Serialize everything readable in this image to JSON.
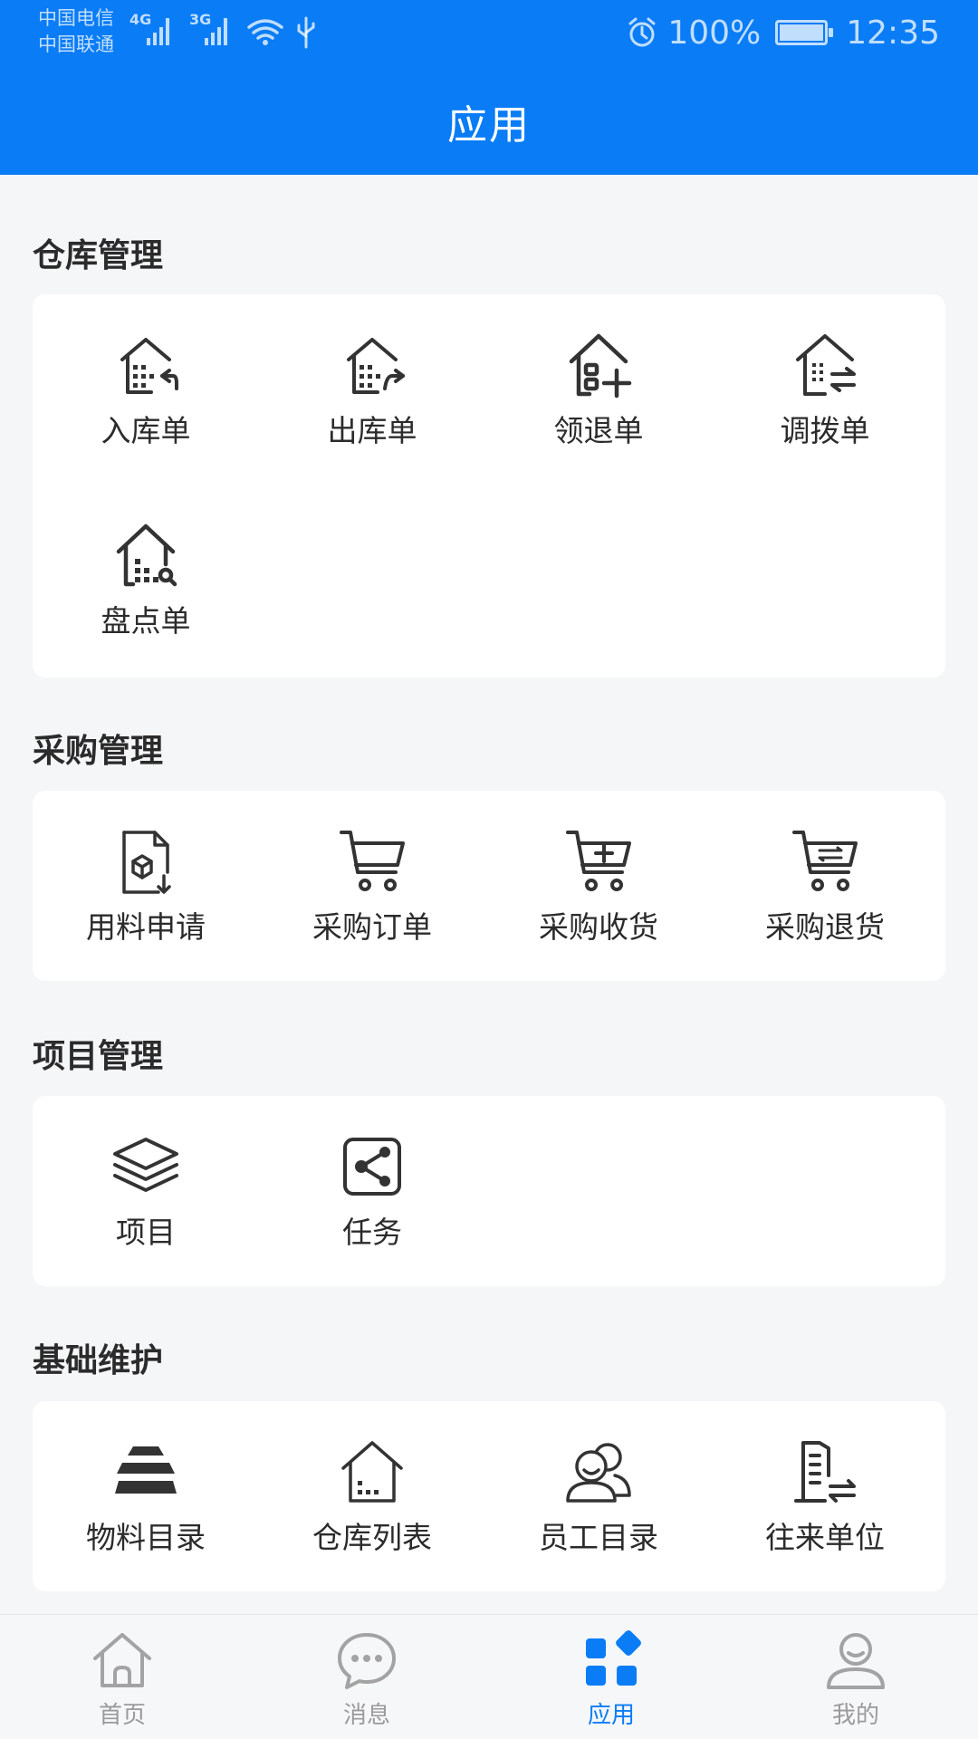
{
  "status_bar": {
    "carrier_1": "中国电信",
    "carrier_2": "中国联通",
    "net_1": "4G",
    "net_2": "3G",
    "battery": "100%",
    "time": "12:35"
  },
  "header": {
    "title": "应用"
  },
  "sections": [
    {
      "title": "仓库管理",
      "items": [
        {
          "label": "入库单",
          "icon": "warehouse-inbound-icon"
        },
        {
          "label": "出库单",
          "icon": "warehouse-outbound-icon"
        },
        {
          "label": "领退单",
          "icon": "warehouse-return-icon"
        },
        {
          "label": "调拨单",
          "icon": "warehouse-transfer-icon"
        },
        {
          "label": "盘点单",
          "icon": "warehouse-inventory-icon"
        }
      ]
    },
    {
      "title": "采购管理",
      "items": [
        {
          "label": "用料申请",
          "icon": "material-request-icon"
        },
        {
          "label": "采购订单",
          "icon": "cart-icon"
        },
        {
          "label": "采购收货",
          "icon": "cart-add-icon"
        },
        {
          "label": "采购退货",
          "icon": "cart-return-icon"
        }
      ]
    },
    {
      "title": "项目管理",
      "items": [
        {
          "label": "项目",
          "icon": "layers-icon"
        },
        {
          "label": "任务",
          "icon": "share-box-icon"
        }
      ]
    },
    {
      "title": "基础维护",
      "items": [
        {
          "label": "物料目录",
          "icon": "stack-icon"
        },
        {
          "label": "仓库列表",
          "icon": "warehouse-list-icon"
        },
        {
          "label": "员工目录",
          "icon": "people-icon"
        },
        {
          "label": "往来单位",
          "icon": "building-exchange-icon"
        }
      ]
    }
  ],
  "tabbar": {
    "items": [
      {
        "label": "首页",
        "icon": "home-icon"
      },
      {
        "label": "消息",
        "icon": "chat-icon"
      },
      {
        "label": "应用",
        "icon": "apps-icon",
        "active": true
      },
      {
        "label": "我的",
        "icon": "user-icon"
      }
    ]
  },
  "colors": {
    "primary": "#0a7cf6",
    "background": "#f5f6f8",
    "card": "#ffffff",
    "text": "#2b2b2b",
    "tab_inactive": "#9a9a9a"
  }
}
